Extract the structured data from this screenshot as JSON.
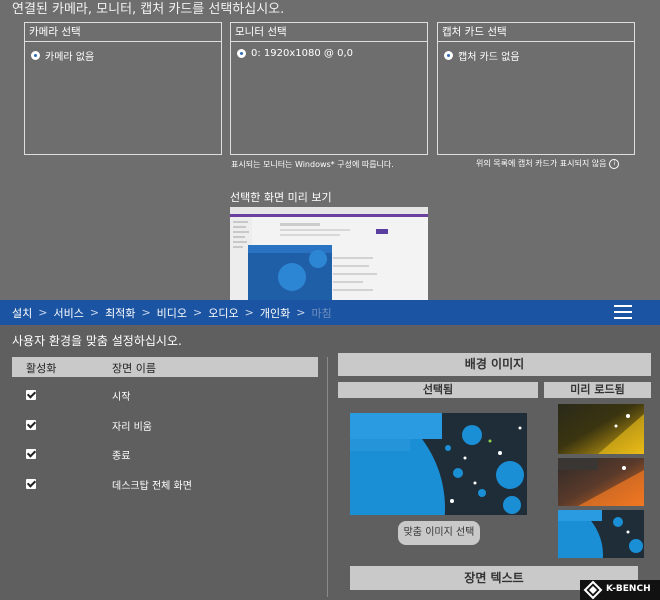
{
  "top": {
    "heading": "연결된 카메라, 모니터, 캡처 카드를 선택하십시오.",
    "camera": {
      "title": "카메라 선택",
      "option": "카메라 없음"
    },
    "monitor": {
      "title": "모니터 선택",
      "option": "0: 1920x1080 @ 0,0",
      "note": "표시되는 모니터는 Windows* 구성에 따릅니다."
    },
    "capture": {
      "title": "캡처 카드 선택",
      "option": "캡처 카드 없음",
      "note": "위의 목록에 캡처 카드가 표시되지 않음"
    },
    "preview_label": "선택한 화면 미리 보기"
  },
  "nav": {
    "crumbs": [
      "설치",
      "서비스",
      "최적화",
      "비디오",
      "오디오",
      "개인화",
      "마침"
    ],
    "separator": ">"
  },
  "bottom": {
    "heading": "사용자 환경을 맞춤 설정하십시오.",
    "table_headers": {
      "active": "활성화",
      "scene_name": "장면 이름"
    },
    "scenes": [
      {
        "name": "시작",
        "checked": true
      },
      {
        "name": "자리 비움",
        "checked": true
      },
      {
        "name": "종료",
        "checked": true
      },
      {
        "name": "데스크탑 전체 화면",
        "checked": true
      }
    ],
    "background_title": "배경 이미지",
    "selected_label": "선택됨",
    "preloaded_label": "미리 로드됨",
    "custom_image_button": "맞춤 이미지 선택",
    "scene_text_title": "장면 텍스트"
  },
  "logo": {
    "text": "K-BENCH"
  },
  "colors": {
    "nav": "#1b54a2",
    "top_bg": "#6e6e6e",
    "bottom_bg": "#5f5f5f",
    "bar": "#c9c9c9",
    "accent_blue": "#1b8fd6"
  }
}
